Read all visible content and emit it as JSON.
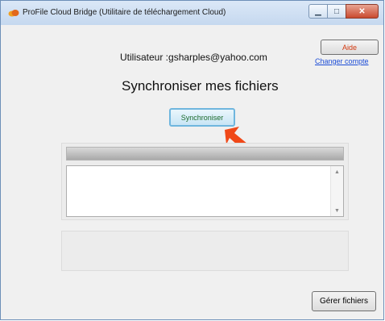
{
  "window": {
    "title": "ProFile Cloud Bridge (Utilitaire de téléchargement Cloud)",
    "controls": {
      "minimize": "▁",
      "maximize": "□",
      "close": "✕"
    }
  },
  "header": {
    "user_label": "Utilisateur :gsharples@yahoo.com",
    "aide_button": "Aide",
    "change_account_link": "Changer compte"
  },
  "main": {
    "heading": "Synchroniser mes fichiers",
    "sync_button": "Synchroniser",
    "progress": 0,
    "scroll_up": "▲",
    "scroll_down": "▼"
  },
  "footer": {
    "manage_files_button": "Gérer fichiers"
  },
  "colors": {
    "annotation_arrow": "#f04818",
    "aide_text": "#d43a10",
    "sync_text": "#1d6b2a",
    "link": "#1a4bd6"
  },
  "icons": {
    "app": "cloud-icon",
    "annotation": "pointer-arrow-icon"
  }
}
